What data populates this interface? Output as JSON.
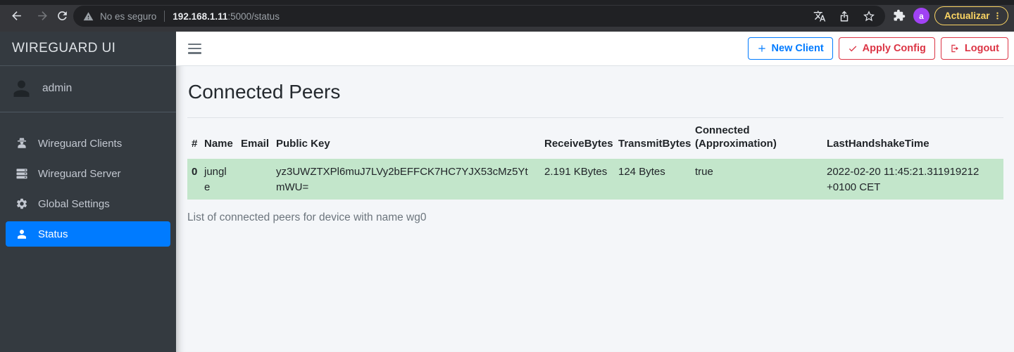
{
  "browser": {
    "security_warning": "No es seguro",
    "url_host": "192.168.1.11",
    "url_path": ":5000/status",
    "avatar_letter": "a",
    "update_label": "Actualizar",
    "icons": [
      "back-arrow-icon",
      "forward-arrow-icon",
      "reload-icon",
      "warning-triangle-icon",
      "translate-icon",
      "share-icon",
      "star-icon",
      "extensions-puzzle-icon",
      "kebab-menu-icon"
    ],
    "colors": {
      "update_yellow": "#fdd663",
      "avatar_purple": "#a142f4",
      "toolbar_bg": "#35363a",
      "omnibox_bg": "#202124"
    }
  },
  "sidebar": {
    "brand": "WIREGUARD UI",
    "user": "admin",
    "items": [
      {
        "label": "Wireguard Clients",
        "icon": "user-secret-icon",
        "active": false
      },
      {
        "label": "Wireguard Server",
        "icon": "server-icon",
        "active": false
      },
      {
        "label": "Global Settings",
        "icon": "gear-icon",
        "active": false
      },
      {
        "label": "Status",
        "icon": "user-icon",
        "active": true
      }
    ],
    "colors": {
      "background": "#343a40",
      "active_blue": "#007bff",
      "text": "#c2c7d0"
    }
  },
  "toolbar": {
    "new_client_label": "New Client",
    "apply_config_label": "Apply Config",
    "logout_label": "Logout",
    "icons": [
      "plus-icon",
      "check-icon",
      "sign-out-icon"
    ],
    "colors": {
      "primary": "#007bff",
      "danger": "#dc3545"
    }
  },
  "main": {
    "title": "Connected Peers",
    "footer_note": "List of connected peers for device with name wg0",
    "table": {
      "columns": [
        "#",
        "Name",
        "Email",
        "Public Key",
        "ReceiveBytes",
        "TransmitBytes",
        "Connected (Approximation)",
        "LastHandshakeTime"
      ],
      "rows": [
        {
          "index": "0",
          "name": "jungle",
          "email": "",
          "public_key": "yz3UWZTXPl6muJ7LVy2bEFFCK7HC7YJX53cMz5YtmWU=",
          "receive_bytes": "2.191 KBytes",
          "transmit_bytes": "124 Bytes",
          "connected": "true",
          "last_handshake": "2022-02-20 11:45:21.311919212 +0100 CET"
        }
      ],
      "colors": {
        "row_highlight": "#c3e6cb"
      }
    }
  }
}
